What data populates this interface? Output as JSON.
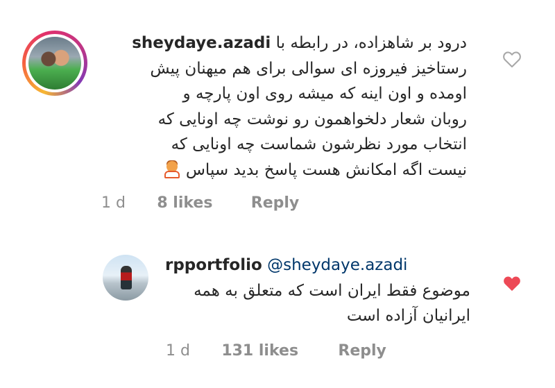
{
  "comments": [
    {
      "username": "sheydaye.azadi",
      "lines": [
        "درود بر شاهزاده، در رابطه با",
        "رستاخیز فیروزه ای سوالی برای هم میهنان پیش",
        "اومده و اون اینه که میشه روی اون پارچه و",
        "روبان شعار دلخواهمون رو نوشت چه اونایی که",
        "انتخاب مورد نظرشون شماست چه اونایی که",
        "نیست اگه امکانش هست پاسخ بدید سپاس"
      ],
      "emoji": "person-raising-hands-emoji",
      "time": "1 d",
      "likes": "8 likes",
      "reply": "Reply",
      "liked": false
    },
    {
      "username": "rpportfolio",
      "mention": "@sheydaye.azadi",
      "lines": [
        "موضوع فقط ایران است که متعلق به همه",
        "ایرانیان آزاده است"
      ],
      "time": "1 d",
      "likes": "131 likes",
      "reply": "Reply",
      "liked": true
    }
  ],
  "colors": {
    "text": "#262626",
    "meta": "#8e8e8e",
    "mention": "#00376b",
    "heart": "#ed4956",
    "heart_outline": "#a8a8a8"
  }
}
